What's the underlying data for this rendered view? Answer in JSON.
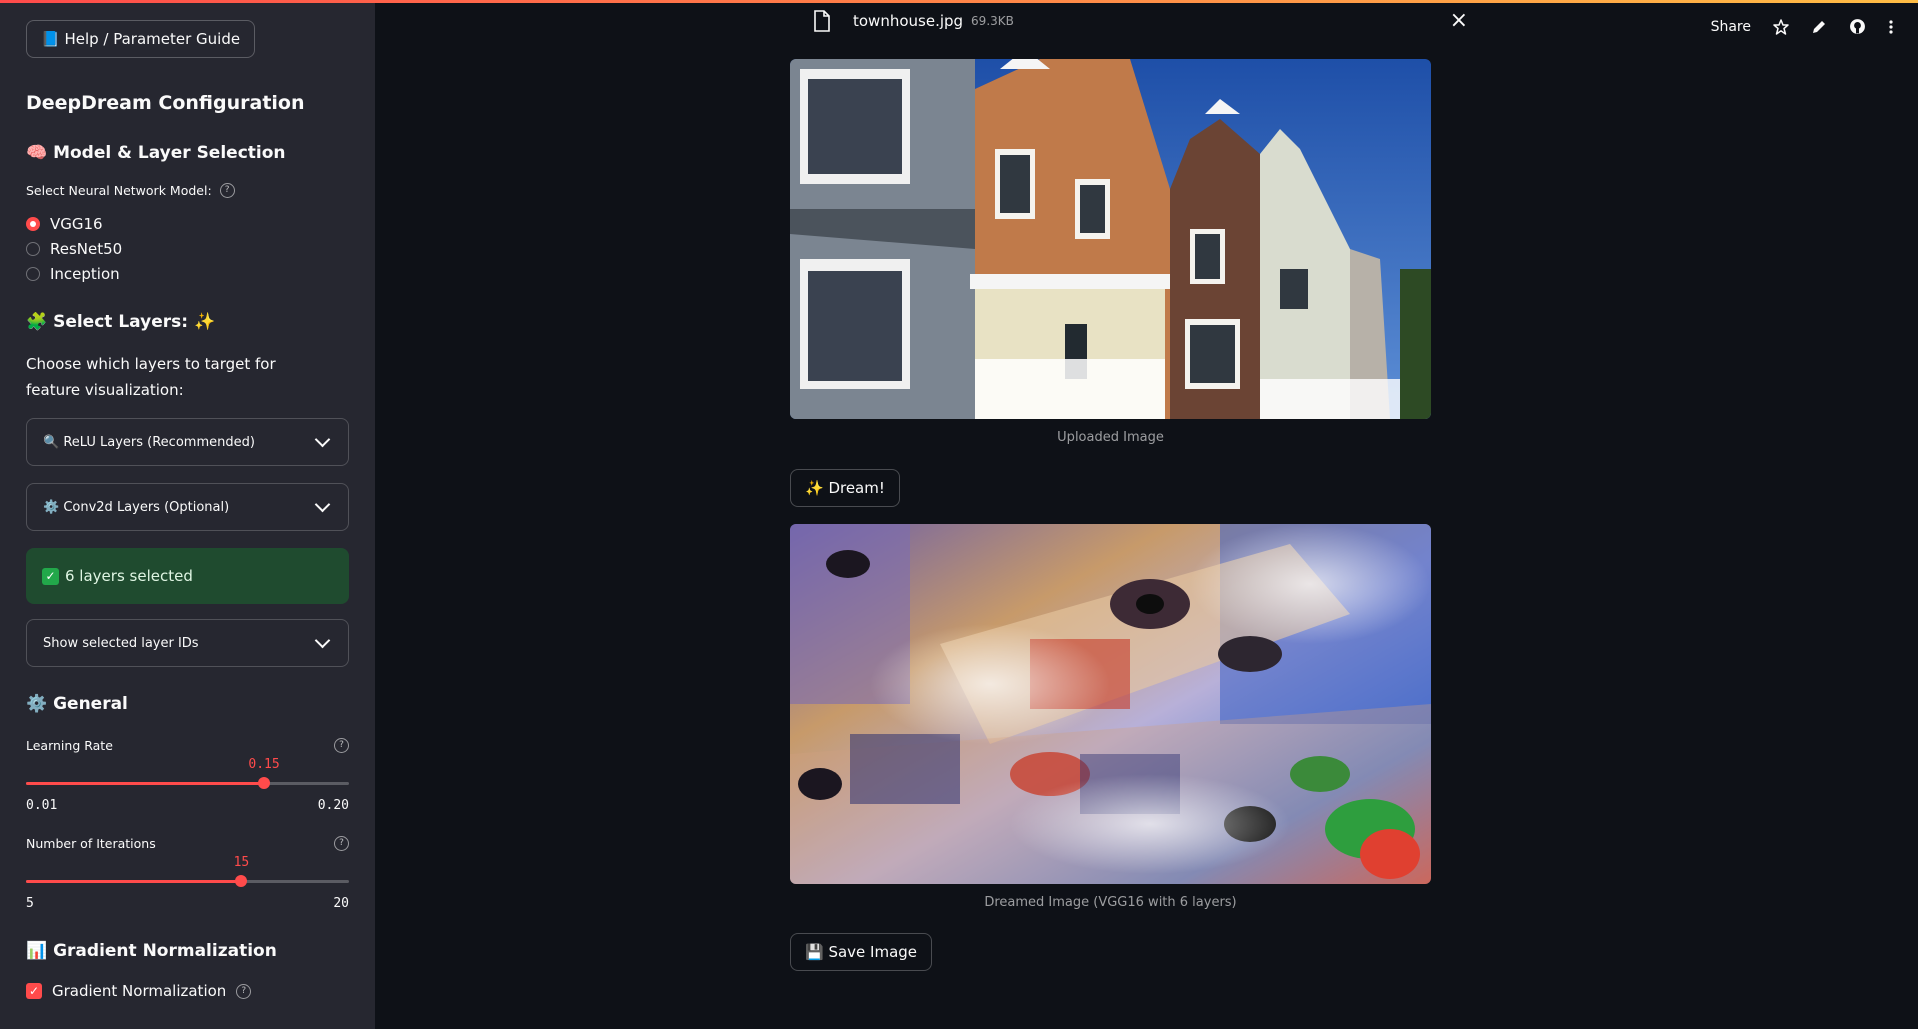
{
  "colors": {
    "accent": "#ff4b4b",
    "sidebar_bg": "#262730",
    "main_bg": "#0e1117",
    "success_bg": "#1f4b2f"
  },
  "sidebar": {
    "help_button": "📘 Help / Parameter Guide",
    "title": "DeepDream Configuration",
    "model_section": {
      "title": "🧠 Model & Layer Selection",
      "label": "Select Neural Network Model:",
      "options": [
        "VGG16",
        "ResNet50",
        "Inception"
      ],
      "selected": "VGG16"
    },
    "layers_section": {
      "title": "🧩 Select Layers: ✨",
      "description": "Choose which layers to target for feature visualization:",
      "relu_expander": "🔍 ReLU Layers (Recommended)",
      "conv_expander": "⚙️ Conv2d Layers (Optional)",
      "status": "6 layers selected",
      "show_ids_expander": "Show selected layer IDs"
    },
    "general_section": {
      "title": "⚙️ General",
      "learning_rate": {
        "label": "Learning Rate",
        "value": "0.15",
        "min": "0.01",
        "max": "0.20",
        "fraction": 0.737
      },
      "iterations": {
        "label": "Number of Iterations",
        "value": "15",
        "min": "5",
        "max": "20",
        "fraction": 0.667
      }
    },
    "gradient_section": {
      "title": "📊 Gradient Normalization",
      "checkbox_label": "Gradient Normalization",
      "checked": true
    }
  },
  "toolbar": {
    "share": "Share",
    "icons": [
      "star-icon",
      "pencil-icon",
      "github-icon",
      "more-vertical-icon"
    ]
  },
  "main": {
    "file": {
      "name": "townhouse.jpg",
      "size": "69.3KB"
    },
    "uploaded_caption": "Uploaded Image",
    "dream_button": "✨ Dream!",
    "dreamed_caption": "Dreamed Image (VGG16 with 6 layers)",
    "save_button": "💾 Save Image"
  }
}
